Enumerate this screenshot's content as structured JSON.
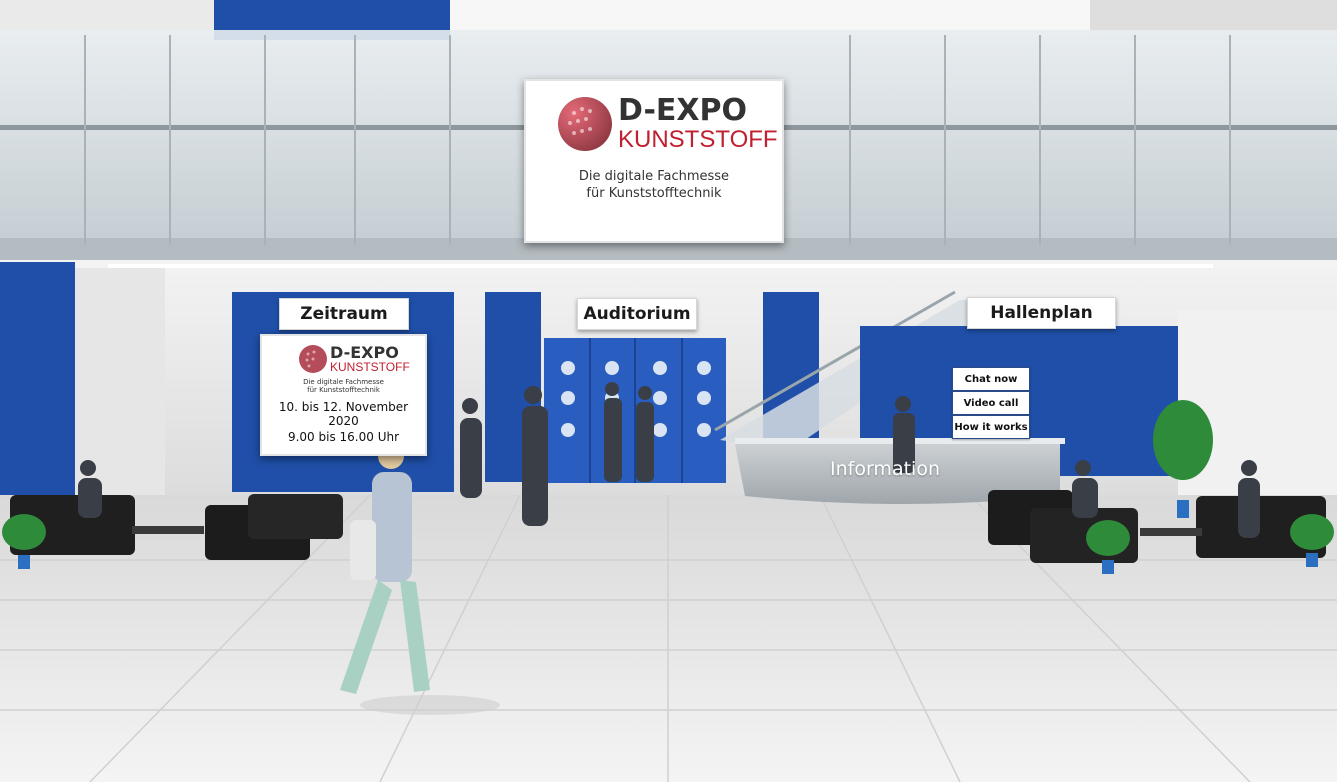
{
  "main_board": {
    "logo_line1": "D-EXPO",
    "logo_line2": "KUNSTSTOFF",
    "tagline_line1": "Die digitale Fachmesse",
    "tagline_line2": "für Kunststofftechnik"
  },
  "zeitraum": {
    "sign_label": "Zeitraum",
    "logo_line1": "D-EXPO",
    "logo_line2": "KUNSTSTOFF",
    "tagline_line1": "Die digitale Fachmesse",
    "tagline_line2": "für Kunststofftechnik",
    "dates": "10. bis 12. November 2020",
    "hours": "9.00 bis 16.00 Uhr"
  },
  "auditorium": {
    "sign_label": "Auditorium"
  },
  "hallenplan": {
    "sign_label": "Hallenplan"
  },
  "info_desk": {
    "label": "Information",
    "buttons": [
      "Chat now",
      "Video call",
      "How it works"
    ]
  },
  "colors": {
    "brand_blue": "#1f4fa8",
    "logo_red": "#c0202f",
    "floor": "#ececec"
  }
}
